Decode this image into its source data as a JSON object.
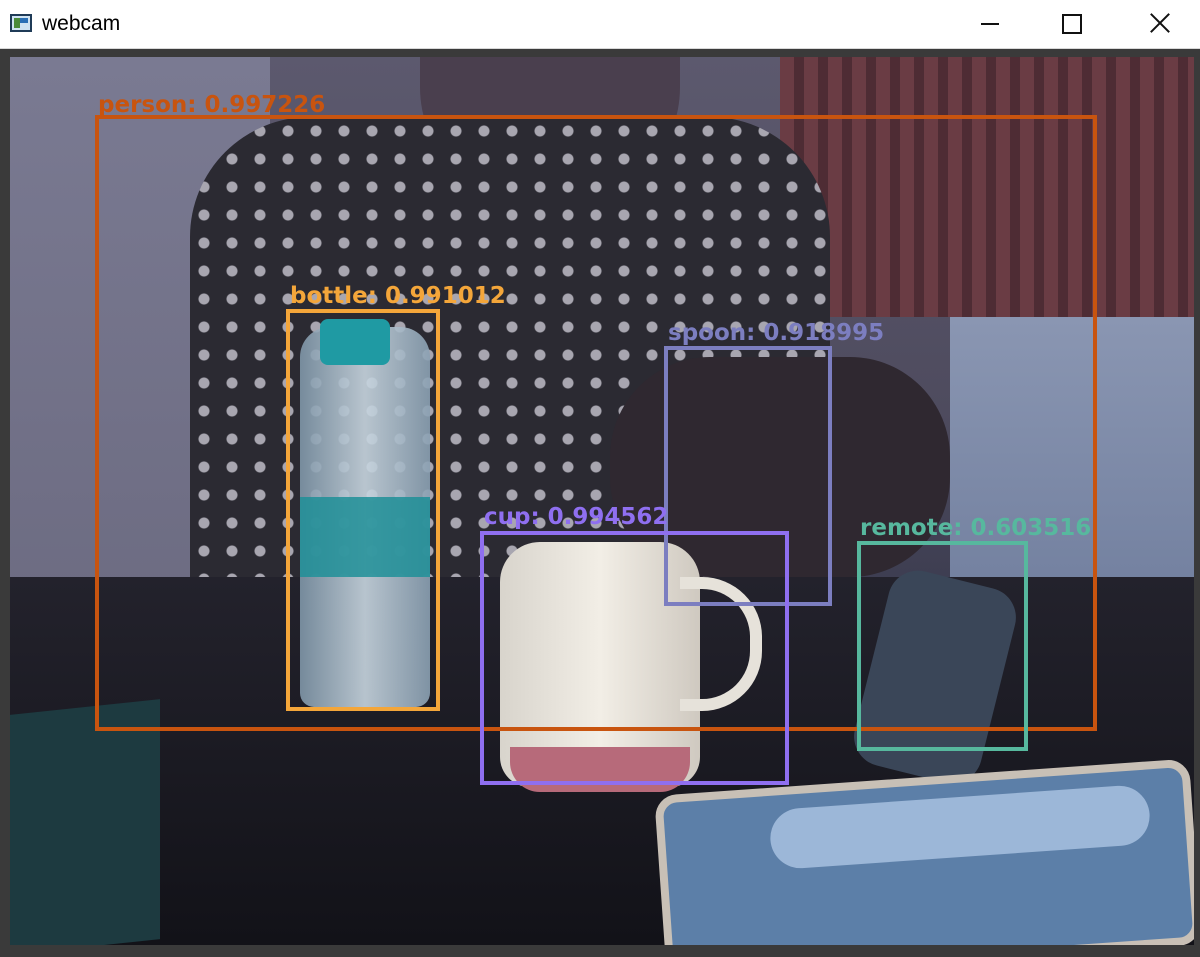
{
  "window": {
    "title": "webcam",
    "controls": [
      "minimize-icon",
      "maximize-icon",
      "close-icon"
    ]
  },
  "video": {
    "detections": [
      {
        "label": "person: 0.997226",
        "color": "#c8540f"
      },
      {
        "label": "bottle: 0.991012",
        "color": "#f4a63a"
      },
      {
        "label": "spoon: 0.918995",
        "color": "#7c7ec0"
      },
      {
        "label": "cup: 0.994562",
        "color": "#8f6ff0"
      },
      {
        "label": "remote: 0.603516",
        "color": "#57b89e"
      }
    ]
  }
}
